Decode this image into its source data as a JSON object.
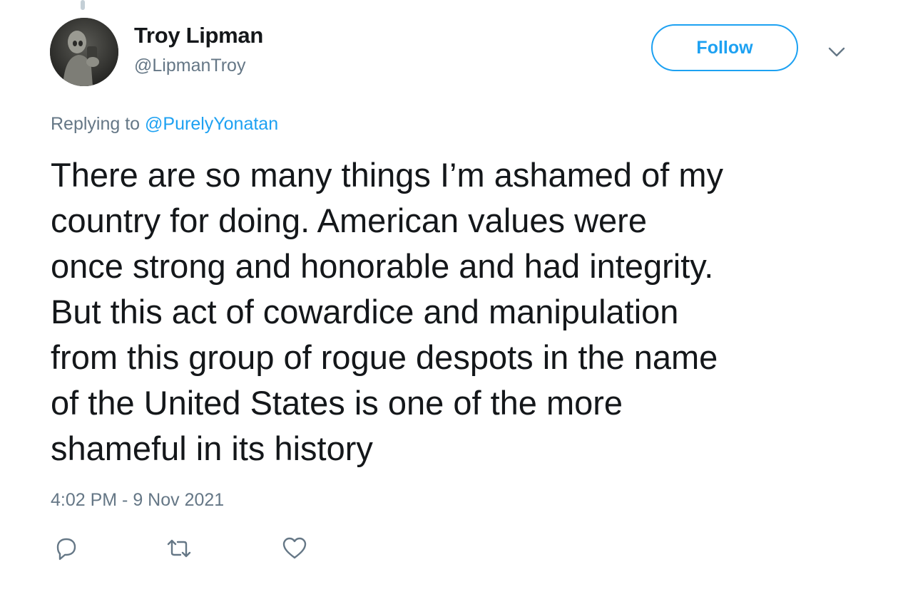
{
  "author": {
    "display_name": "Troy Lipman",
    "handle": "@LipmanTroy"
  },
  "header": {
    "follow_label": "Follow",
    "menu_icon": "chevron-down-icon"
  },
  "reply_context": {
    "prefix": "Replying to",
    "mention": "@PurelyYonatan"
  },
  "tweet": {
    "text": "There are so many things I’m ashamed of my\ncountry for doing. American values were\nonce strong and honorable and had integrity.\nBut this act of cowardice and manipulation\nfrom this group of rogue despots in the name\nof the United States is one of the more\nshameful in its history",
    "timestamp": "4:02 PM - 9 Nov 2021"
  },
  "actions": {
    "reply_icon": "reply-icon",
    "retweet_icon": "retweet-icon",
    "like_icon": "heart-icon"
  },
  "colors": {
    "accent": "#1da1f2",
    "secondary_text": "#657786",
    "primary_text": "#14171a"
  }
}
